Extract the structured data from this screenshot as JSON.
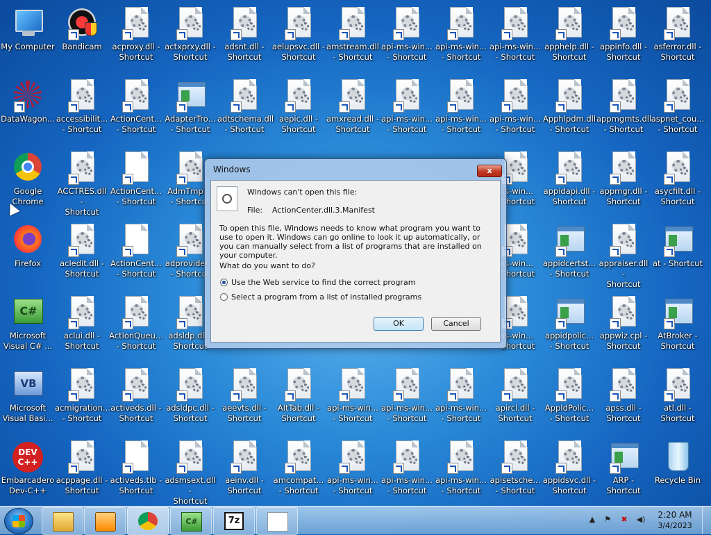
{
  "desktop_icons": [
    {
      "label": "My Computer",
      "kind": "computer"
    },
    {
      "label": "Bandicam",
      "kind": "bandicam"
    },
    {
      "label": "acproxy.dll -\nShortcut",
      "kind": "dll"
    },
    {
      "label": "actxprxy.dll -\nShortcut",
      "kind": "dll"
    },
    {
      "label": "adsnt.dll -\nShortcut",
      "kind": "dll"
    },
    {
      "label": "aelupsvc.dll -\nShortcut",
      "kind": "dll"
    },
    {
      "label": "amstream.dll\n- Shortcut",
      "kind": "dll"
    },
    {
      "label": "api-ms-win...\n- Shortcut",
      "kind": "dll"
    },
    {
      "label": "api-ms-win...\n- Shortcut",
      "kind": "dll"
    },
    {
      "label": "api-ms-win...\n- Shortcut",
      "kind": "dll"
    },
    {
      "label": "apphelp.dll -\nShortcut",
      "kind": "dll"
    },
    {
      "label": "appinfo.dll -\nShortcut",
      "kind": "dll"
    },
    {
      "label": "asferror.dll -\nShortcut",
      "kind": "dll"
    },
    {
      "label": "DataWagon...",
      "kind": "molecule"
    },
    {
      "label": "accessibilit...\n- Shortcut",
      "kind": "dll"
    },
    {
      "label": "ActionCent...\n- Shortcut",
      "kind": "dll"
    },
    {
      "label": "AdapterTro...\n- Shortcut",
      "kind": "app"
    },
    {
      "label": "adtschema.dll\n- Shortcut",
      "kind": "dll"
    },
    {
      "label": "aepic.dll -\nShortcut",
      "kind": "dll"
    },
    {
      "label": "amxread.dll -\nShortcut",
      "kind": "dll"
    },
    {
      "label": "api-ms-win...\n- Shortcut",
      "kind": "dll"
    },
    {
      "label": "api-ms-win...\n- Shortcut",
      "kind": "dll"
    },
    {
      "label": "api-ms-win...\n- Shortcut",
      "kind": "dll"
    },
    {
      "label": "Apphlpdm.dll\n- Shortcut",
      "kind": "dll"
    },
    {
      "label": "appmgmts.dll\n- Shortcut",
      "kind": "dll"
    },
    {
      "label": "aspnet_cou...\n- Shortcut",
      "kind": "dll"
    },
    {
      "label": "Google\nChrome",
      "kind": "chrome"
    },
    {
      "label": "ACCTRES.dll -\nShortcut",
      "kind": "dll"
    },
    {
      "label": "ActionCent...\n- Shortcut",
      "kind": "blank"
    },
    {
      "label": "AdmTmpl...\n- Shortcut",
      "kind": "dll"
    },
    {
      "label": "ms-win...\n- Shortcut",
      "kind": "dll"
    },
    {
      "label": "appidapi.dll -\nShortcut",
      "kind": "dll"
    },
    {
      "label": "appmgr.dll -\nShortcut",
      "kind": "dll"
    },
    {
      "label": "asycfilt.dll -\nShortcut",
      "kind": "dll"
    },
    {
      "label": "Firefox",
      "kind": "firefox"
    },
    {
      "label": "acledit.dll -\nShortcut",
      "kind": "dll"
    },
    {
      "label": "ActionCent...\n- Shortcut",
      "kind": "blank"
    },
    {
      "label": "adprovider...\n- Shortcut",
      "kind": "dll"
    },
    {
      "label": "ms-win...\n- Shortcut",
      "kind": "dll"
    },
    {
      "label": "appidcertst...\n- Shortcut",
      "kind": "app"
    },
    {
      "label": "appraiser.dll -\nShortcut",
      "kind": "dll"
    },
    {
      "label": "at - Shortcut",
      "kind": "app"
    },
    {
      "label": "Microsoft\nVisual C# ...",
      "kind": "csharp"
    },
    {
      "label": "aclui.dll -\nShortcut",
      "kind": "dll"
    },
    {
      "label": "ActionQueu...\n- Shortcut",
      "kind": "dll"
    },
    {
      "label": "adsldp.dll -\nShortcut",
      "kind": "dll"
    },
    {
      "label": "ms-win...\n- Shortcut",
      "kind": "dll"
    },
    {
      "label": "appidpolic...\n- Shortcut",
      "kind": "app"
    },
    {
      "label": "appwiz.cpl -\nShortcut",
      "kind": "dll"
    },
    {
      "label": "AtBroker -\nShortcut",
      "kind": "app"
    },
    {
      "label": "Microsoft\nVisual Basi...",
      "kind": "vb"
    },
    {
      "label": "acmigration...\n- Shortcut",
      "kind": "dll"
    },
    {
      "label": "activeds.dll -\nShortcut",
      "kind": "dll"
    },
    {
      "label": "adsldpc.dll -\nShortcut",
      "kind": "dll"
    },
    {
      "label": "aeevts.dll -\nShortcut",
      "kind": "dll"
    },
    {
      "label": "AltTab.dll -\nShortcut",
      "kind": "dll"
    },
    {
      "label": "api-ms-win...\n- Shortcut",
      "kind": "dll"
    },
    {
      "label": "api-ms-win...\n- Shortcut",
      "kind": "dll"
    },
    {
      "label": "api-ms-win...\n- Shortcut",
      "kind": "dll"
    },
    {
      "label": "apircl.dll -\nShortcut",
      "kind": "dll"
    },
    {
      "label": "AppIdPolic...\n- Shortcut",
      "kind": "dll"
    },
    {
      "label": "apss.dll -\nShortcut",
      "kind": "dll"
    },
    {
      "label": "atl.dll -\nShortcut",
      "kind": "dll"
    },
    {
      "label": "Embarcadero\nDev-C++",
      "kind": "dev"
    },
    {
      "label": "acppage.dll -\nShortcut",
      "kind": "dll"
    },
    {
      "label": "activeds.tlb -\nShortcut",
      "kind": "blank"
    },
    {
      "label": "adsmsext.dll -\nShortcut",
      "kind": "dll"
    },
    {
      "label": "aeinv.dll -\nShortcut",
      "kind": "dll"
    },
    {
      "label": "amcompat...\n- Shortcut",
      "kind": "dll"
    },
    {
      "label": "api-ms-win...\n- Shortcut",
      "kind": "dll"
    },
    {
      "label": "api-ms-win...\n- Shortcut",
      "kind": "dll"
    },
    {
      "label": "api-ms-win...\n- Shortcut",
      "kind": "dll"
    },
    {
      "label": "apisetsche...\n- Shortcut",
      "kind": "dll"
    },
    {
      "label": "appidsvc.dll -\nShortcut",
      "kind": "dll"
    },
    {
      "label": "ARP -\nShortcut",
      "kind": "app"
    },
    {
      "label": "Recycle Bin",
      "kind": "recycle"
    }
  ],
  "dialog": {
    "title": "Windows",
    "close_label": "x",
    "heading": "Windows can't open this file:",
    "file_label": "File:",
    "file_name": "ActionCenter.dll.3.Manifest",
    "explanation": "To open this file, Windows needs to know what program you want to use to open it. Windows can go online to look it up automatically, or you can manually select from a list of programs that are installed on your computer.",
    "question": "What do you want to do?",
    "option_web": "Use the Web service to find the correct program",
    "option_list": "Select a program from a list of installed programs",
    "selected_option": "web",
    "ok_label": "OK",
    "cancel_label": "Cancel"
  },
  "taskbar": {
    "seven_zip_label": "7z",
    "csharp_label": "C#"
  },
  "clock": {
    "time": "2:20 AM",
    "date": "3/4/2023"
  }
}
